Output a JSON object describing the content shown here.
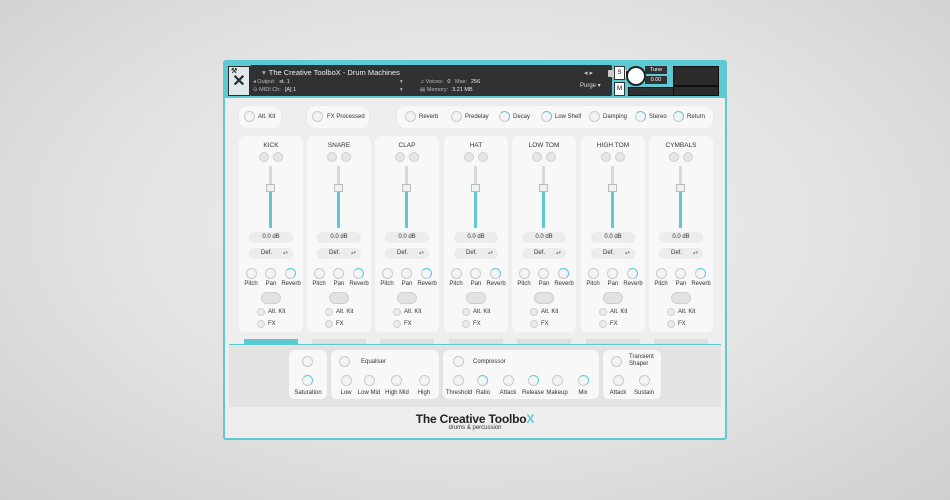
{
  "app": {
    "title": "The Creative ToolboX - Drum Machines"
  },
  "header": {
    "output_label": "Output:",
    "output_value": "st. 1",
    "midi_label": "MIDI Ch:",
    "midi_value": "[A] 1",
    "voices_label": "Voices:",
    "voices_value": "0",
    "max_label": "Max:",
    "max_value": "256",
    "memory_label": "Memory:",
    "memory_value": "3.21 MB",
    "purge": "Purge",
    "tune_label": "Tune",
    "tune_value": "0.00",
    "s_button": "S",
    "m_button": "M"
  },
  "top_controls": {
    "alt_kit": "Alt. Kit",
    "fx_processed": "FX Processed",
    "reverb": "Reverb",
    "predelay": "Predelay",
    "decay": "Decay",
    "low_shelf": "Low Shelf",
    "damping": "Damping",
    "stereo": "Stereo",
    "return": "Return"
  },
  "channel_labels": {
    "db": "0.0  dB",
    "def": "Def.",
    "pitch": "Pitch",
    "pan": "Pan",
    "reverb": "Reverb",
    "alt_kit": "Alt. Kit",
    "fx": "FX"
  },
  "channels": [
    {
      "name": "KICK"
    },
    {
      "name": "SNARE"
    },
    {
      "name": "CLAP"
    },
    {
      "name": "HAT"
    },
    {
      "name": "LOW TOM"
    },
    {
      "name": "HIGH TOM"
    },
    {
      "name": "CYMBALS"
    }
  ],
  "fx": {
    "saturation": "Saturation",
    "equaliser": "Equaliser",
    "eq_low": "Low",
    "eq_low_mid": "Low Mid",
    "eq_high_mid": "High Mid",
    "eq_high": "High",
    "compressor": "Compressor",
    "threshold": "Threshold",
    "ratio": "Ratio",
    "attack": "Attack",
    "release": "Release",
    "makeup": "Makeup",
    "mix": "Mix",
    "transient_shaper": "Transient Shaper",
    "ts_attack": "Attack",
    "ts_sustain": "Sustain"
  },
  "footer": {
    "brand": "The Creative Toolbo",
    "brand_x": "X",
    "subtitle": "drums & percussion"
  },
  "colors": {
    "accent": "#5cc9d3",
    "panel": "#f8f8f8",
    "dark": "#2f3132"
  }
}
